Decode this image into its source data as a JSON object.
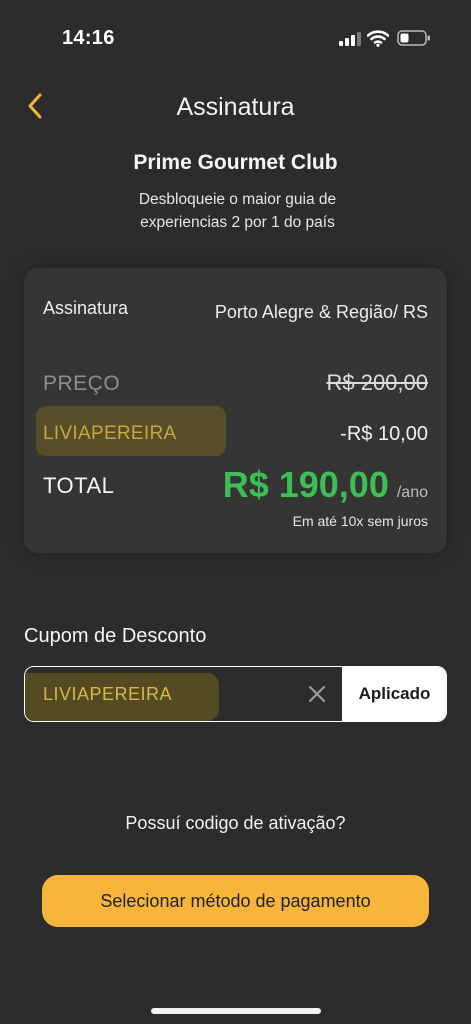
{
  "status_bar": {
    "time": "14:16"
  },
  "header": {
    "title": "Assinatura"
  },
  "club": {
    "name": "Prime Gourmet Club",
    "description": "Desbloqueie o maior guia de experiencias 2 por 1 do país"
  },
  "summary": {
    "subscription_label": "Assinatura",
    "subscription_value": "Porto Alegre & Região/ RS",
    "price_label": "PREÇO",
    "price_value": "R$ 200,00",
    "coupon_code": "LIVIAPEREIRA",
    "discount_value": "-R$ 10,00",
    "total_label": "TOTAL",
    "total_value": "R$ 190,00",
    "total_period": "/ano",
    "installments": "Em até 10x sem juros"
  },
  "coupon": {
    "title": "Cupom de Desconto",
    "value": "LIVIAPEREIRA",
    "applied_label": "Aplicado"
  },
  "activation_link": "Possuí codigo de ativação?",
  "pay_button": "Selecionar método de pagamento",
  "colors": {
    "background": "#2c2c2c",
    "accent": "#f7b53b",
    "total_green": "#3cbf55",
    "coupon_gold": "#c9a640"
  }
}
